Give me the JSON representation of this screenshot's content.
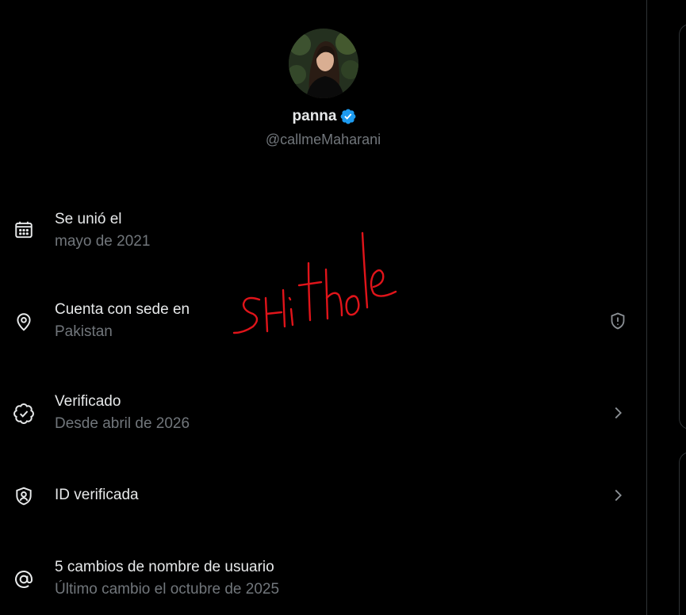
{
  "profile": {
    "name": "panna",
    "handle": "@callmeMaharani",
    "verified_badge_color": "#1d9bf0"
  },
  "rows": [
    {
      "icon": "calendar-icon",
      "label": "Se unió el",
      "sub": "mayo de 2021"
    },
    {
      "icon": "location-pin-icon",
      "label": "Cuenta con sede en",
      "sub": "Pakistan",
      "trailing": "shield-alert-icon"
    },
    {
      "icon": "verified-badge-outline-icon",
      "label": "Verificado",
      "sub": "Desde abril de 2026",
      "trailing": "chevron-right-icon"
    },
    {
      "icon": "id-shield-icon",
      "label": "ID verificada",
      "trailing": "chevron-right-icon"
    },
    {
      "icon": "at-sign-icon",
      "label": "5 cambios de nombre de usuario",
      "sub": "Último cambio el octubre de 2025"
    }
  ],
  "annotation": {
    "handwritten_text": "SHithole",
    "color": "#e0141a"
  },
  "colors": {
    "background": "#000000",
    "primary_text": "#e7e9ea",
    "secondary_text": "#71767b",
    "border": "#2f3336"
  }
}
